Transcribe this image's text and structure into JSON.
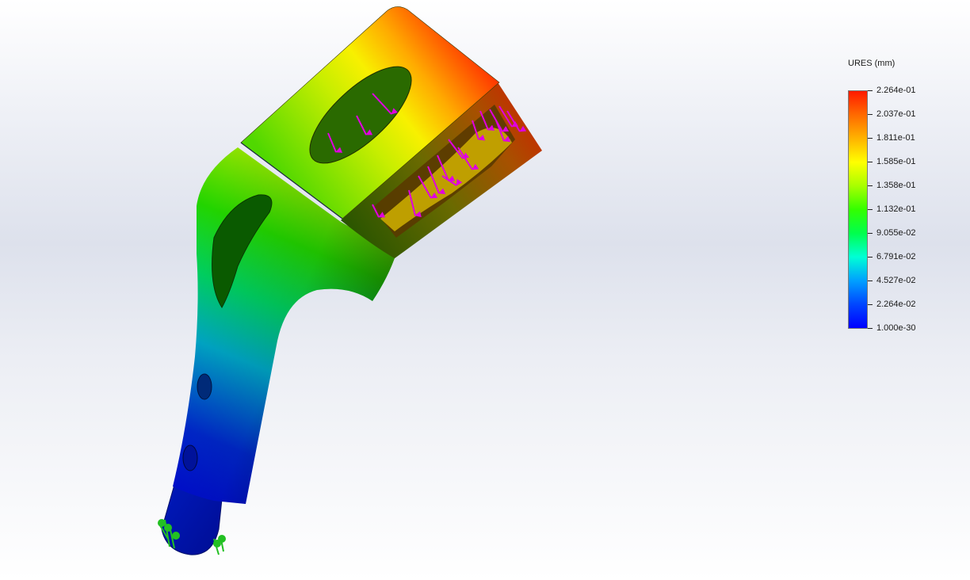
{
  "legend": {
    "title": "URES (mm)",
    "colors": [
      "#ff1a00",
      "#ff6a00",
      "#ffb300",
      "#ffff00",
      "#a8ff00",
      "#33ff00",
      "#00ff4d",
      "#00ffd5",
      "#00a0ff",
      "#0046ff",
      "#0000ff"
    ],
    "ticks": [
      {
        "label": "2.264e-01"
      },
      {
        "label": "2.037e-01"
      },
      {
        "label": "1.811e-01"
      },
      {
        "label": "1.585e-01"
      },
      {
        "label": "1.358e-01"
      },
      {
        "label": "1.132e-01"
      },
      {
        "label": "9.055e-02"
      },
      {
        "label": "6.791e-02"
      },
      {
        "label": "4.527e-02"
      },
      {
        "label": "2.264e-02"
      },
      {
        "label": "1.000e-30"
      }
    ]
  },
  "model": {
    "load_arrow_color": "#e000e0",
    "fixture_color": "#22c022"
  }
}
